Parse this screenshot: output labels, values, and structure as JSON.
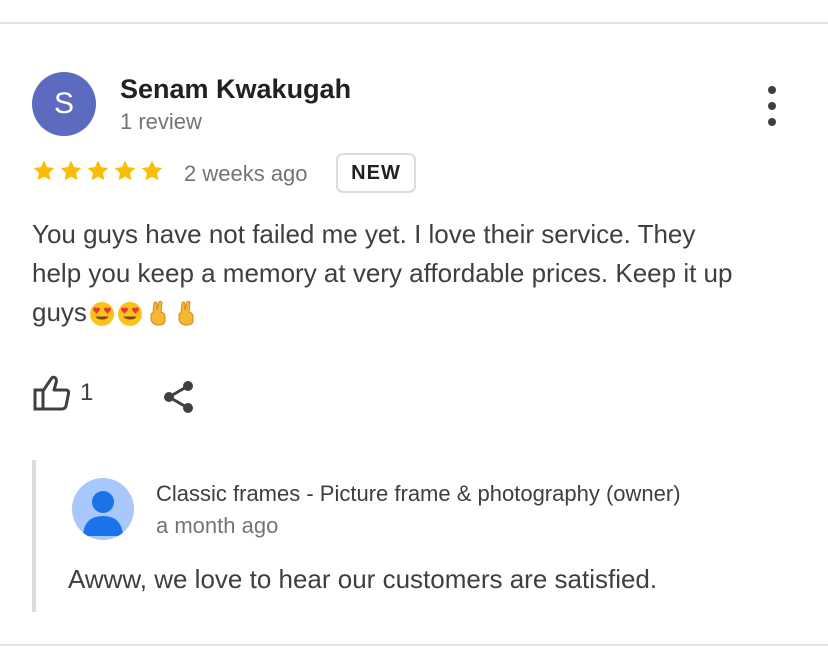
{
  "review": {
    "avatar_initial": "S",
    "reviewer_name": "Senam Kwakugah",
    "review_count": "1 review",
    "rating": 5,
    "max_rating": 5,
    "time_ago": "2 weeks ago",
    "badge": "NEW",
    "text_line1": "You guys have not failed me yet. I love their service. They",
    "text_line2": "help you keep a memory at very affordable prices. Keep it up",
    "text_line3": "guys",
    "emojis": [
      "heart-eyes-emoji",
      "heart-eyes-emoji",
      "crossed-fingers-emoji",
      "crossed-fingers-emoji"
    ],
    "like_count": "1"
  },
  "owner_response": {
    "name": "Classic frames - Picture frame & photography (owner)",
    "time_ago": "a month ago",
    "text": "Awww, we love to hear our customers are satisfied."
  },
  "colors": {
    "avatar": "#5c6bc0",
    "star": "#fbbc04",
    "owner_avatar": "#a8c7fa",
    "owner_avatar_person": "#1a73e8",
    "secondary_text": "#70757a"
  },
  "icons": {
    "more": "more-vert-icon",
    "like": "thumbs-up-icon",
    "share": "share-icon",
    "owner_avatar": "person-icon"
  }
}
